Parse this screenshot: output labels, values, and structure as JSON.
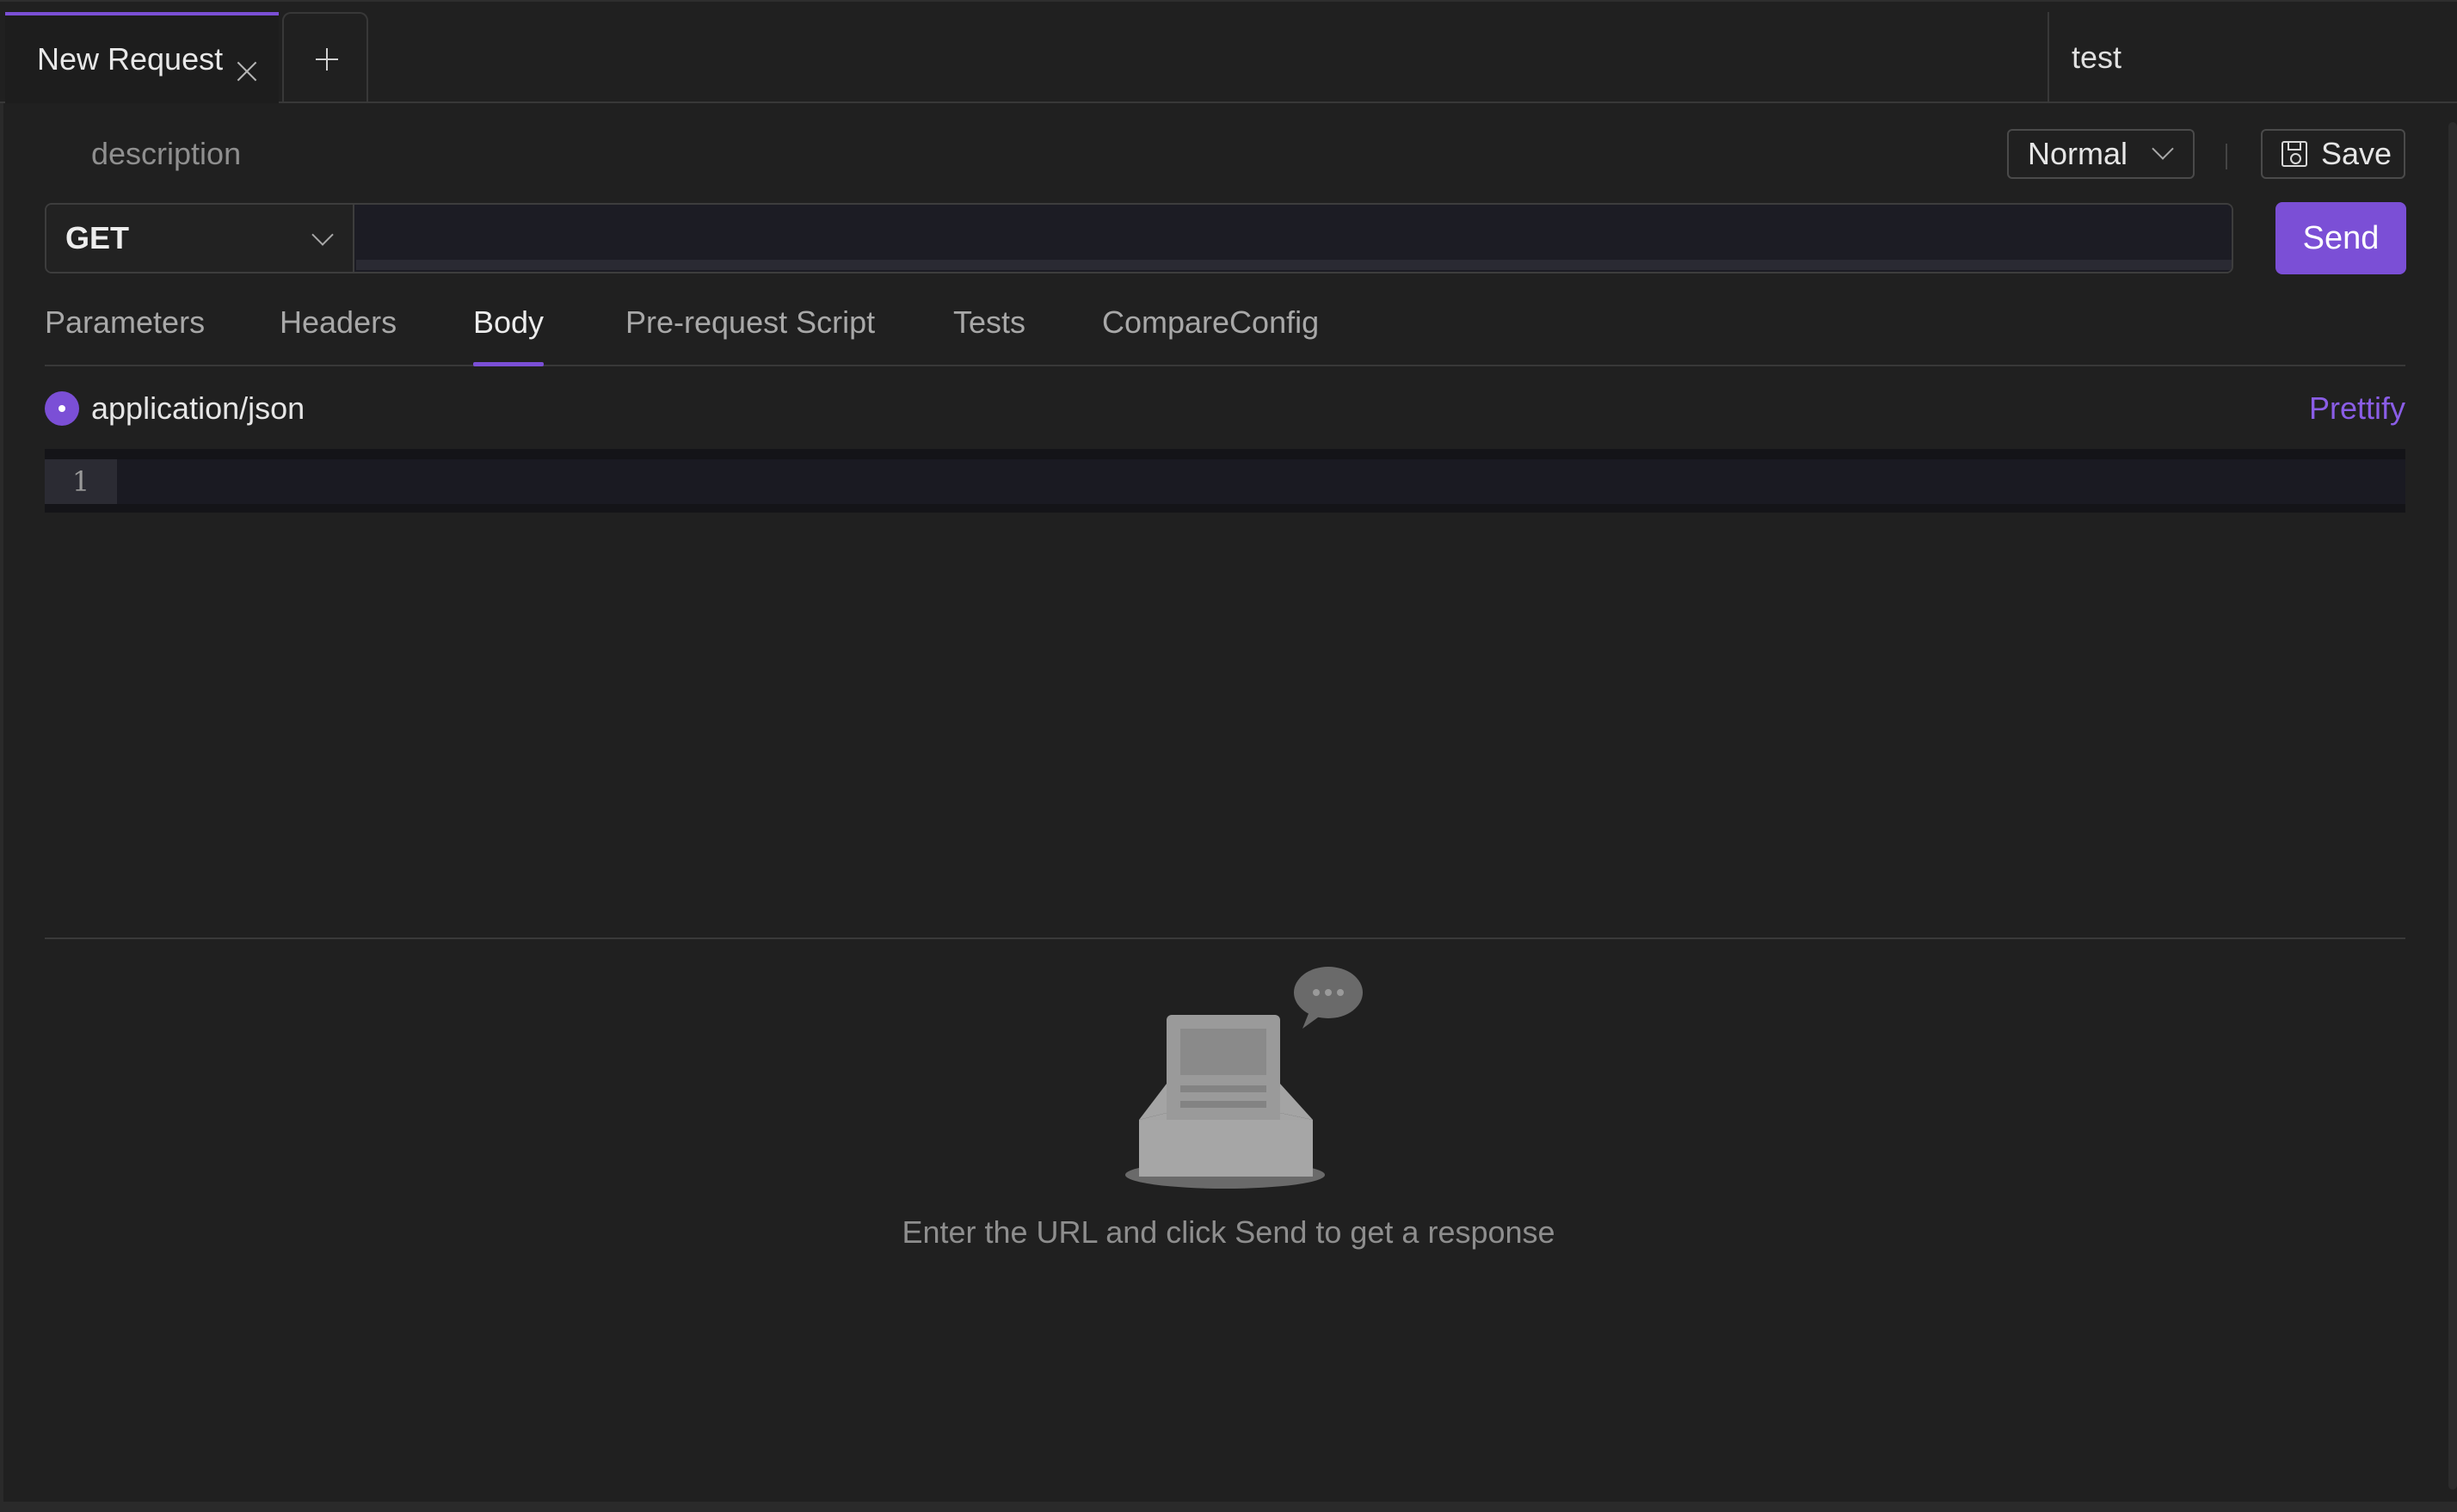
{
  "tabs": [
    {
      "label": "New Request"
    }
  ],
  "environment": {
    "selected": "test"
  },
  "request": {
    "description_placeholder": "description",
    "mode": "Normal",
    "save_label": "Save",
    "method": "GET",
    "url": "",
    "send_label": "Send"
  },
  "request_tabs": [
    {
      "label": "Parameters"
    },
    {
      "label": "Headers"
    },
    {
      "label": "Body"
    },
    {
      "label": "Pre-request Script"
    },
    {
      "label": "Tests"
    },
    {
      "label": "CompareConfig"
    }
  ],
  "active_request_tab": "Body",
  "body": {
    "content_type": "application/json",
    "prettify_label": "Prettify",
    "line_numbers": [
      "1"
    ]
  },
  "response": {
    "empty_message": "Enter the URL and click Send to get a response"
  },
  "colors": {
    "accent": "#7b4fd6",
    "background": "#202020",
    "text": "#e6e6e6",
    "muted": "#8e8e8e"
  },
  "icons": [
    "close-icon",
    "plus-icon",
    "chevron-down-icon",
    "save-icon",
    "empty-inbox-icon"
  ]
}
